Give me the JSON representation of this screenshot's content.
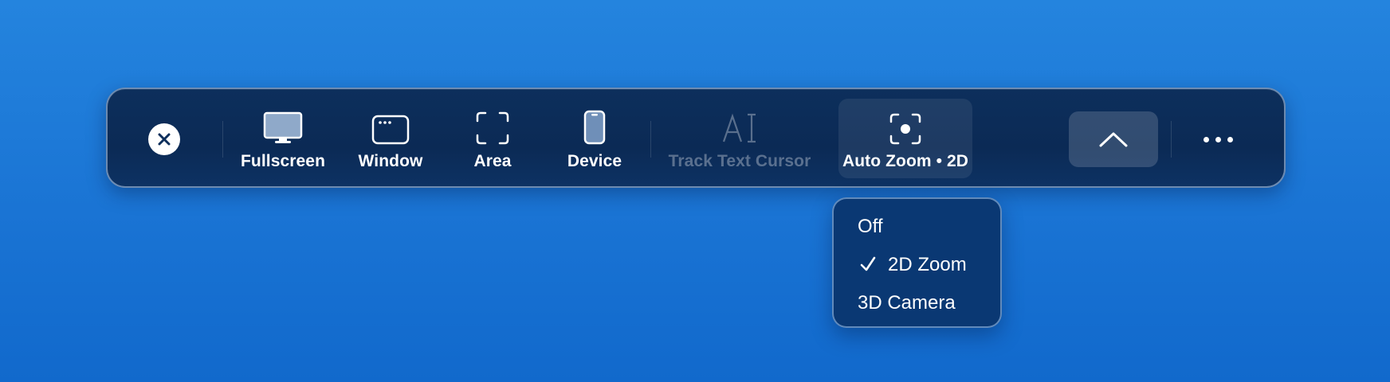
{
  "toolbar": {
    "close_icon": "close-icon",
    "tools": [
      {
        "id": "fullscreen",
        "label": "Fullscreen",
        "icon": "monitor-icon"
      },
      {
        "id": "window",
        "label": "Window",
        "icon": "window-icon"
      },
      {
        "id": "area",
        "label": "Area",
        "icon": "area-selection-icon"
      },
      {
        "id": "device",
        "label": "Device",
        "icon": "phone-icon"
      },
      {
        "id": "track-text-cursor",
        "label": "Track Text Cursor",
        "icon": "text-cursor-icon",
        "disabled": true
      },
      {
        "id": "auto-zoom",
        "label": "Auto Zoom • 2D",
        "icon": "focus-target-icon",
        "active": true
      }
    ],
    "collapse_icon": "chevron-up-icon",
    "more_icon": "ellipsis-icon"
  },
  "zoom_menu": {
    "items": [
      {
        "label": "Off",
        "checked": false
      },
      {
        "label": "2D Zoom",
        "checked": true
      },
      {
        "label": "3D Camera",
        "checked": false
      }
    ],
    "check_icon": "checkmark-icon"
  },
  "colors": {
    "background": "#1a74d4",
    "toolbar": "#0b2a55",
    "menu": "#0a3873",
    "text": "#ffffff",
    "disabled_text": "#5a6f8c"
  }
}
